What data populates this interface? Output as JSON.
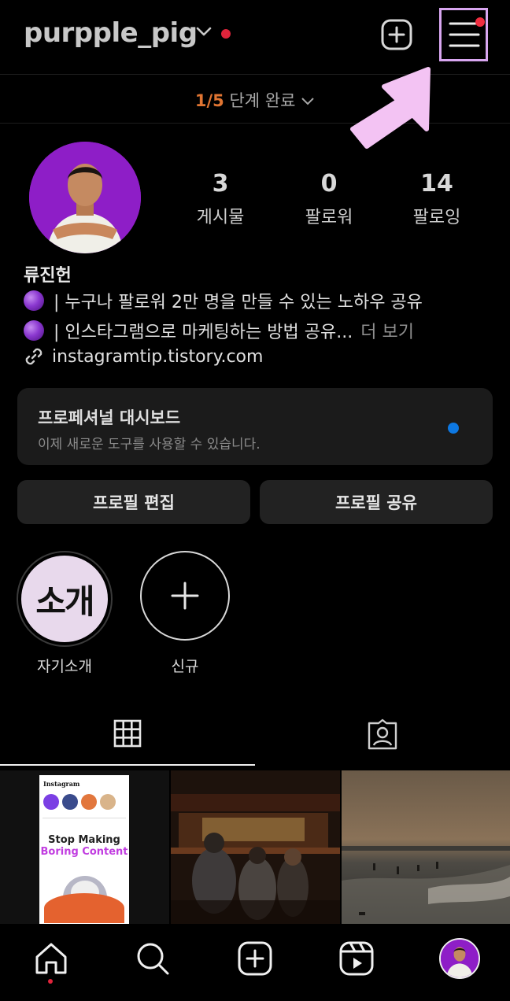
{
  "header": {
    "username": "purpple_pig",
    "icons": [
      "chevron-down-icon",
      "plus-square-icon",
      "menu-icon"
    ]
  },
  "steps": {
    "progress": "1/5",
    "label": "단계 완료"
  },
  "stats": [
    {
      "value": "3",
      "label": "게시물"
    },
    {
      "value": "0",
      "label": "팔로워"
    },
    {
      "value": "14",
      "label": "팔로잉"
    }
  ],
  "profile": {
    "name": "류진헌",
    "bio": [
      {
        "text": "| 누구나 팔로워 2만 명을 만들 수 있는 노하우 공유"
      },
      {
        "text": "| 인스타그램으로 마케팅하는 방법 공유...",
        "more": "더 보기"
      }
    ],
    "link": "instagramtip.tistory.com"
  },
  "dashboard": {
    "title": "프로페셔널 대시보드",
    "subtitle": "이제 새로운 도구를 사용할 수 있습니다."
  },
  "buttons": {
    "edit": "프로필 편집",
    "share": "프로필 공유"
  },
  "highlights": [
    {
      "cover": "소개",
      "label": "자기소개"
    },
    {
      "label": "신규"
    }
  ],
  "posts": [
    {
      "header": "Instagram",
      "headline1": "Stop Making",
      "headline2": "Boring Content"
    },
    {},
    {}
  ],
  "colors": {
    "accent_progress": "#e07532",
    "notification": "#e0243b",
    "highlight_box": "#d8a6f0",
    "dashboard_dot": "#0d78e2"
  }
}
